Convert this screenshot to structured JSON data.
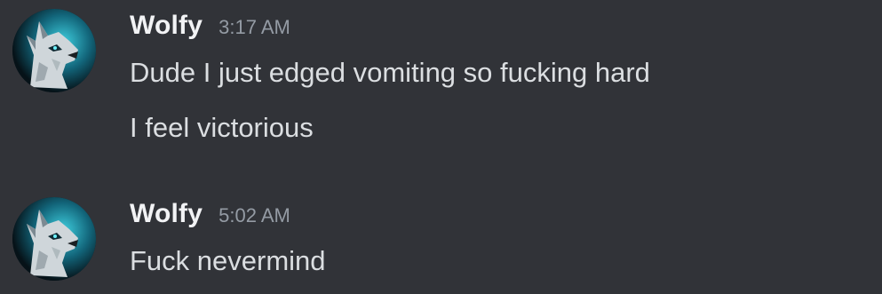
{
  "messages": [
    {
      "author": "Wolfy",
      "timestamp": "3:17 AM",
      "lines": [
        "Dude I just edged vomiting so fucking hard",
        "I feel victorious"
      ]
    },
    {
      "author": "Wolfy",
      "timestamp": "5:02 AM",
      "lines": [
        "Fuck nevermind"
      ]
    }
  ],
  "colors": {
    "background": "#313338",
    "username": "#f2f3f5",
    "timestamp": "#949ba4",
    "message_text": "#dbdee1"
  },
  "icons": {
    "avatar": "wolf-avatar-icon"
  }
}
